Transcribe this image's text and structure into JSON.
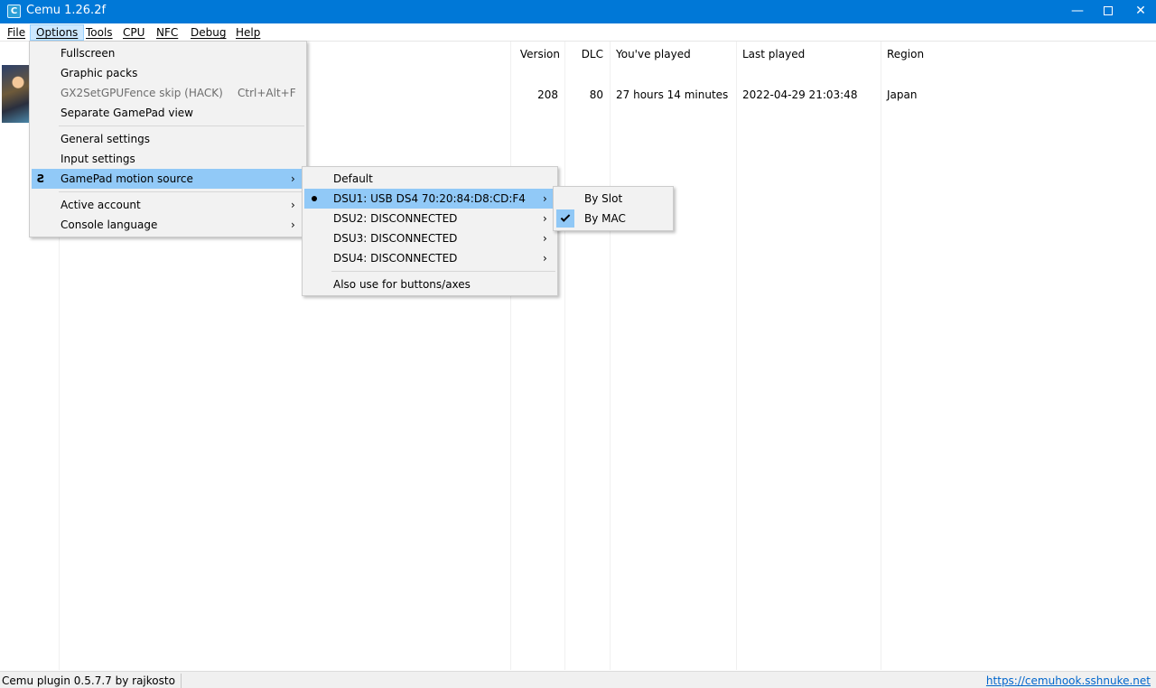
{
  "window": {
    "title": "Cemu 1.26.2f",
    "icon_letter": "C",
    "minimize_glyph": "—",
    "close_glyph": "✕"
  },
  "menubar": {
    "items": [
      {
        "label": "File"
      },
      {
        "label": "Options"
      },
      {
        "label": "Tools"
      },
      {
        "label": "CPU"
      },
      {
        "label": "NFC"
      },
      {
        "label": "Debug"
      },
      {
        "label": "Help"
      }
    ]
  },
  "game_list": {
    "columns": [
      "Version",
      "DLC",
      "You've played",
      "Last played",
      "Region"
    ],
    "rows": [
      {
        "version": "208",
        "dlc": "80",
        "played": "27 hours 14 minutes",
        "last_played": "2022-04-29 21:03:48",
        "region": "Japan"
      }
    ]
  },
  "options_menu": {
    "items": [
      {
        "label": "Fullscreen"
      },
      {
        "label": "Graphic packs"
      },
      {
        "label": "GX2SetGPUFence skip (HACK)",
        "shortcut": "Ctrl+Alt+F",
        "disabled": true
      },
      {
        "label": "Separate GamePad view"
      },
      {
        "label": "General settings"
      },
      {
        "label": "Input settings"
      },
      {
        "label": "GamePad motion source",
        "submenu": true,
        "highlighted": true
      },
      {
        "label": "Active account",
        "submenu": true
      },
      {
        "label": "Console language",
        "submenu": true
      }
    ],
    "submenu_arrow": "›",
    "motion_icon": "Ƨ"
  },
  "motion_source_menu": {
    "items": [
      {
        "label": "Default"
      },
      {
        "label": "DSU1: USB DS4 70:20:84:D8:CD:F4",
        "selected": true,
        "submenu": true,
        "highlighted": true
      },
      {
        "label": "DSU2: DISCONNECTED",
        "submenu": true
      },
      {
        "label": "DSU3: DISCONNECTED",
        "submenu": true
      },
      {
        "label": "DSU4: DISCONNECTED",
        "submenu": true
      },
      {
        "label": "Also use for buttons/axes"
      }
    ]
  },
  "dsu1_menu": {
    "items": [
      {
        "label": "By Slot"
      },
      {
        "label": "By MAC",
        "checked": true
      }
    ]
  },
  "statusbar": {
    "left": "Cemu plugin 0.5.7.7 by rajkosto",
    "right": "https://cemuhook.sshnuke.net"
  }
}
